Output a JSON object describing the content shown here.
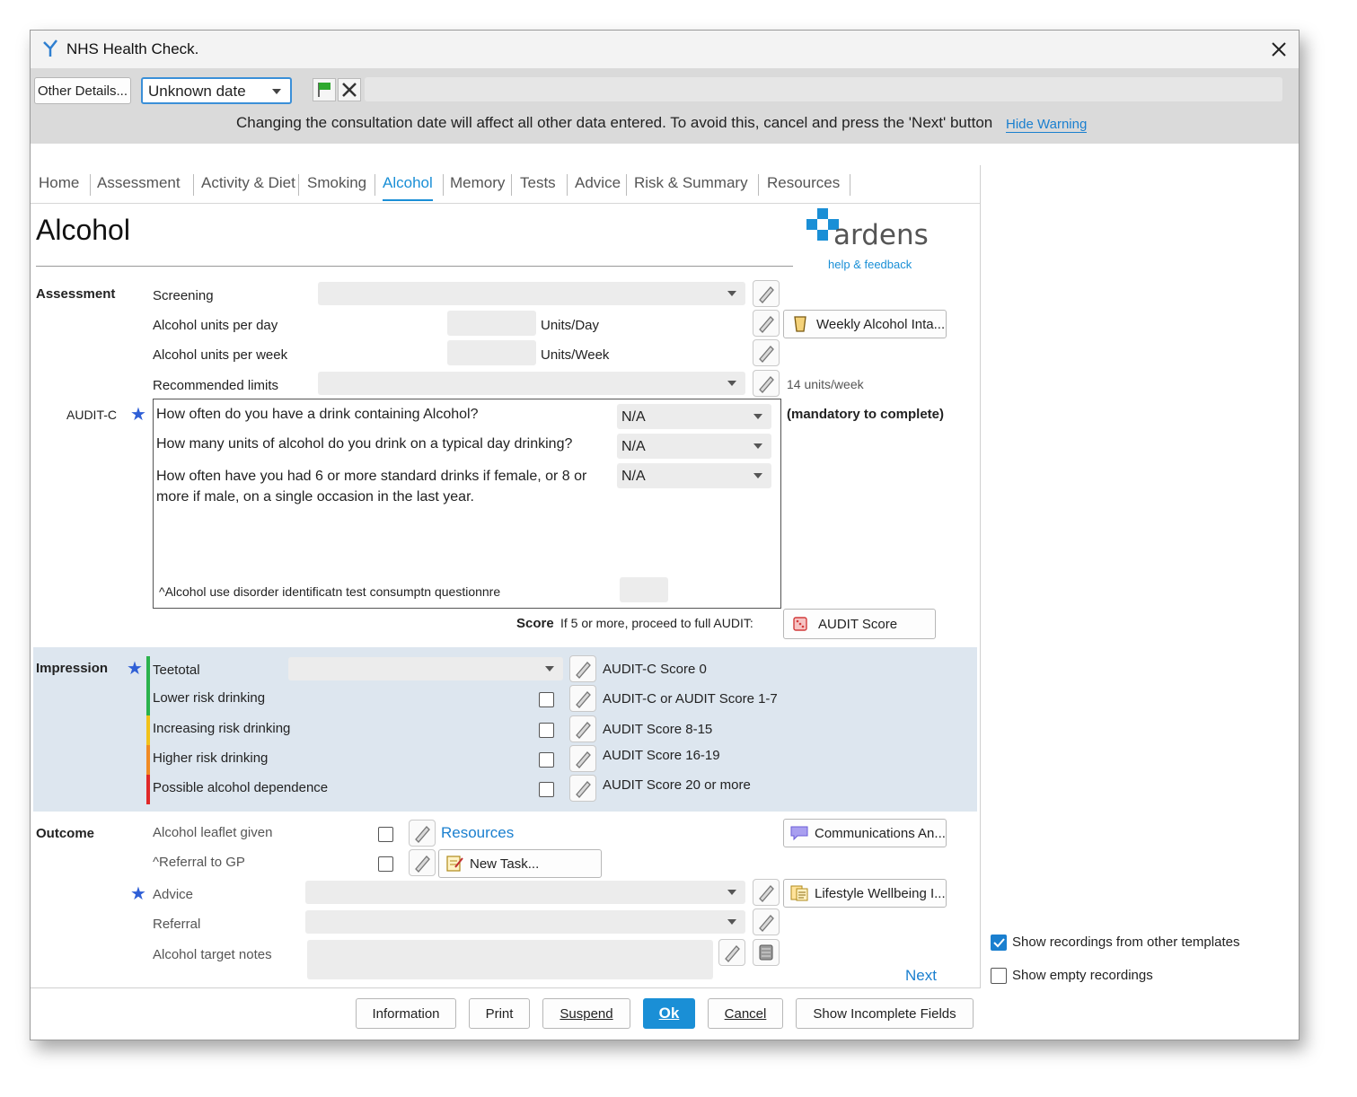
{
  "window": {
    "title": "NHS Health Check."
  },
  "toolbar": {
    "other_details": "Other Details...",
    "date_value": "Unknown date"
  },
  "warning": {
    "text": "Changing the consultation date will affect all other data entered. To avoid this, cancel and press the 'Next' button",
    "hide_link": "Hide Warning"
  },
  "tabs": [
    {
      "label": "Home"
    },
    {
      "label": "Assessment"
    },
    {
      "label": "Activity & Diet"
    },
    {
      "label": "Smoking"
    },
    {
      "label": "Alcohol"
    },
    {
      "label": "Memory"
    },
    {
      "label": "Tests"
    },
    {
      "label": "Advice"
    },
    {
      "label": "Risk & Summary"
    },
    {
      "label": "Resources"
    }
  ],
  "active_tab": "Alcohol",
  "page": {
    "title": "Alcohol"
  },
  "logo": {
    "name": "ardens",
    "help": "help & feedback"
  },
  "assessment": {
    "heading": "Assessment",
    "screening": "Screening",
    "units_day": "Alcohol units per day",
    "units_day_suffix": "Units/Day",
    "units_week": "Alcohol units per week",
    "units_week_suffix": "Units/Week",
    "recommended": "Recommended limits",
    "recommended_note": "14 units/week",
    "weekly_button": "Weekly Alcohol Inta..."
  },
  "auditc": {
    "label": "AUDIT-C",
    "mandatory": "(mandatory to complete)",
    "questions": [
      {
        "text": "How often do you have a drink containing Alcohol?",
        "value": "N/A"
      },
      {
        "text": "How many units of alcohol do you drink on a typical day drinking?",
        "value": "N/A"
      },
      {
        "text": "How often have you had 6 or more standard drinks if female, or 8 or more if male,  on a single occasion in the last year.",
        "value": "N/A"
      }
    ],
    "footnote": "^Alcohol use disorder identificatn test consumptn questionnre",
    "score_label": "Score",
    "score_hint": "If 5 or more, proceed to full AUDIT:",
    "audit_button": "AUDIT Score"
  },
  "impression": {
    "heading": "Impression",
    "rows": [
      {
        "label": "Teetotal",
        "note": "AUDIT-C Score 0",
        "color": "#2bb24c"
      },
      {
        "label": "Lower risk drinking",
        "note": "AUDIT-C or AUDIT Score 1-7",
        "color": "#2bb24c"
      },
      {
        "label": "Increasing risk drinking",
        "note": "AUDIT Score 8-15",
        "color": "#f2c21a"
      },
      {
        "label": "Higher risk drinking",
        "note": "AUDIT Score 16-19",
        "color": "#f08a24"
      },
      {
        "label": "Possible alcohol dependence",
        "note": "AUDIT Score 20 or more",
        "color": "#e02828"
      }
    ]
  },
  "outcome": {
    "heading": "Outcome",
    "leaflet": "Alcohol leaflet given",
    "resources_link": "Resources",
    "referral_gp": "^Referral to GP",
    "new_task": "New Task...",
    "advice": "Advice",
    "referral": "Referral",
    "target_notes": "Alcohol target notes",
    "comms_button": "Communications An...",
    "lifestyle_button": "Lifestyle Wellbeing I...",
    "next_link": "Next"
  },
  "options": {
    "show_other": "Show recordings from other templates",
    "show_empty": "Show empty recordings"
  },
  "footer": {
    "information": "Information",
    "print": "Print",
    "suspend": "Suspend",
    "ok": "Ok",
    "cancel": "Cancel",
    "incomplete": "Show Incomplete Fields"
  },
  "colors": {
    "accent": "#1a8fd6",
    "star": "#2f5fd6",
    "impression_bg": "#dde6ef"
  }
}
